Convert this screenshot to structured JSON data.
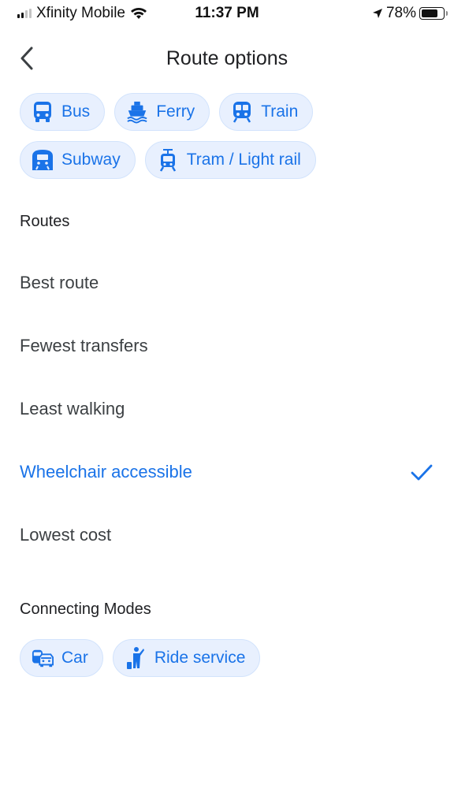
{
  "status_bar": {
    "carrier": "Xfinity Mobile",
    "time": "11:37 PM",
    "battery": "78%",
    "battery_level": 0.78,
    "signal_bars": 2
  },
  "header": {
    "title": "Route options",
    "back_icon": "chevron-left-icon"
  },
  "transit_modes": [
    {
      "label": "Bus",
      "icon": "bus-icon"
    },
    {
      "label": "Ferry",
      "icon": "ferry-icon"
    },
    {
      "label": "Train",
      "icon": "train-icon"
    },
    {
      "label": "Subway",
      "icon": "subway-icon"
    },
    {
      "label": "Tram / Light rail",
      "icon": "tram-icon"
    }
  ],
  "routes": {
    "title": "Routes",
    "items": [
      {
        "label": "Best route",
        "selected": false
      },
      {
        "label": "Fewest transfers",
        "selected": false
      },
      {
        "label": "Least walking",
        "selected": false
      },
      {
        "label": "Wheelchair accessible",
        "selected": true
      },
      {
        "label": "Lowest cost",
        "selected": false
      }
    ]
  },
  "connecting_modes": {
    "title": "Connecting Modes",
    "items": [
      {
        "label": "Car",
        "icon": "car-icon"
      },
      {
        "label": "Ride service",
        "icon": "ride-service-icon"
      }
    ]
  },
  "colors": {
    "accent": "#1a73e8",
    "chip_bg": "#e8f0fe",
    "text": "#3c4043"
  }
}
